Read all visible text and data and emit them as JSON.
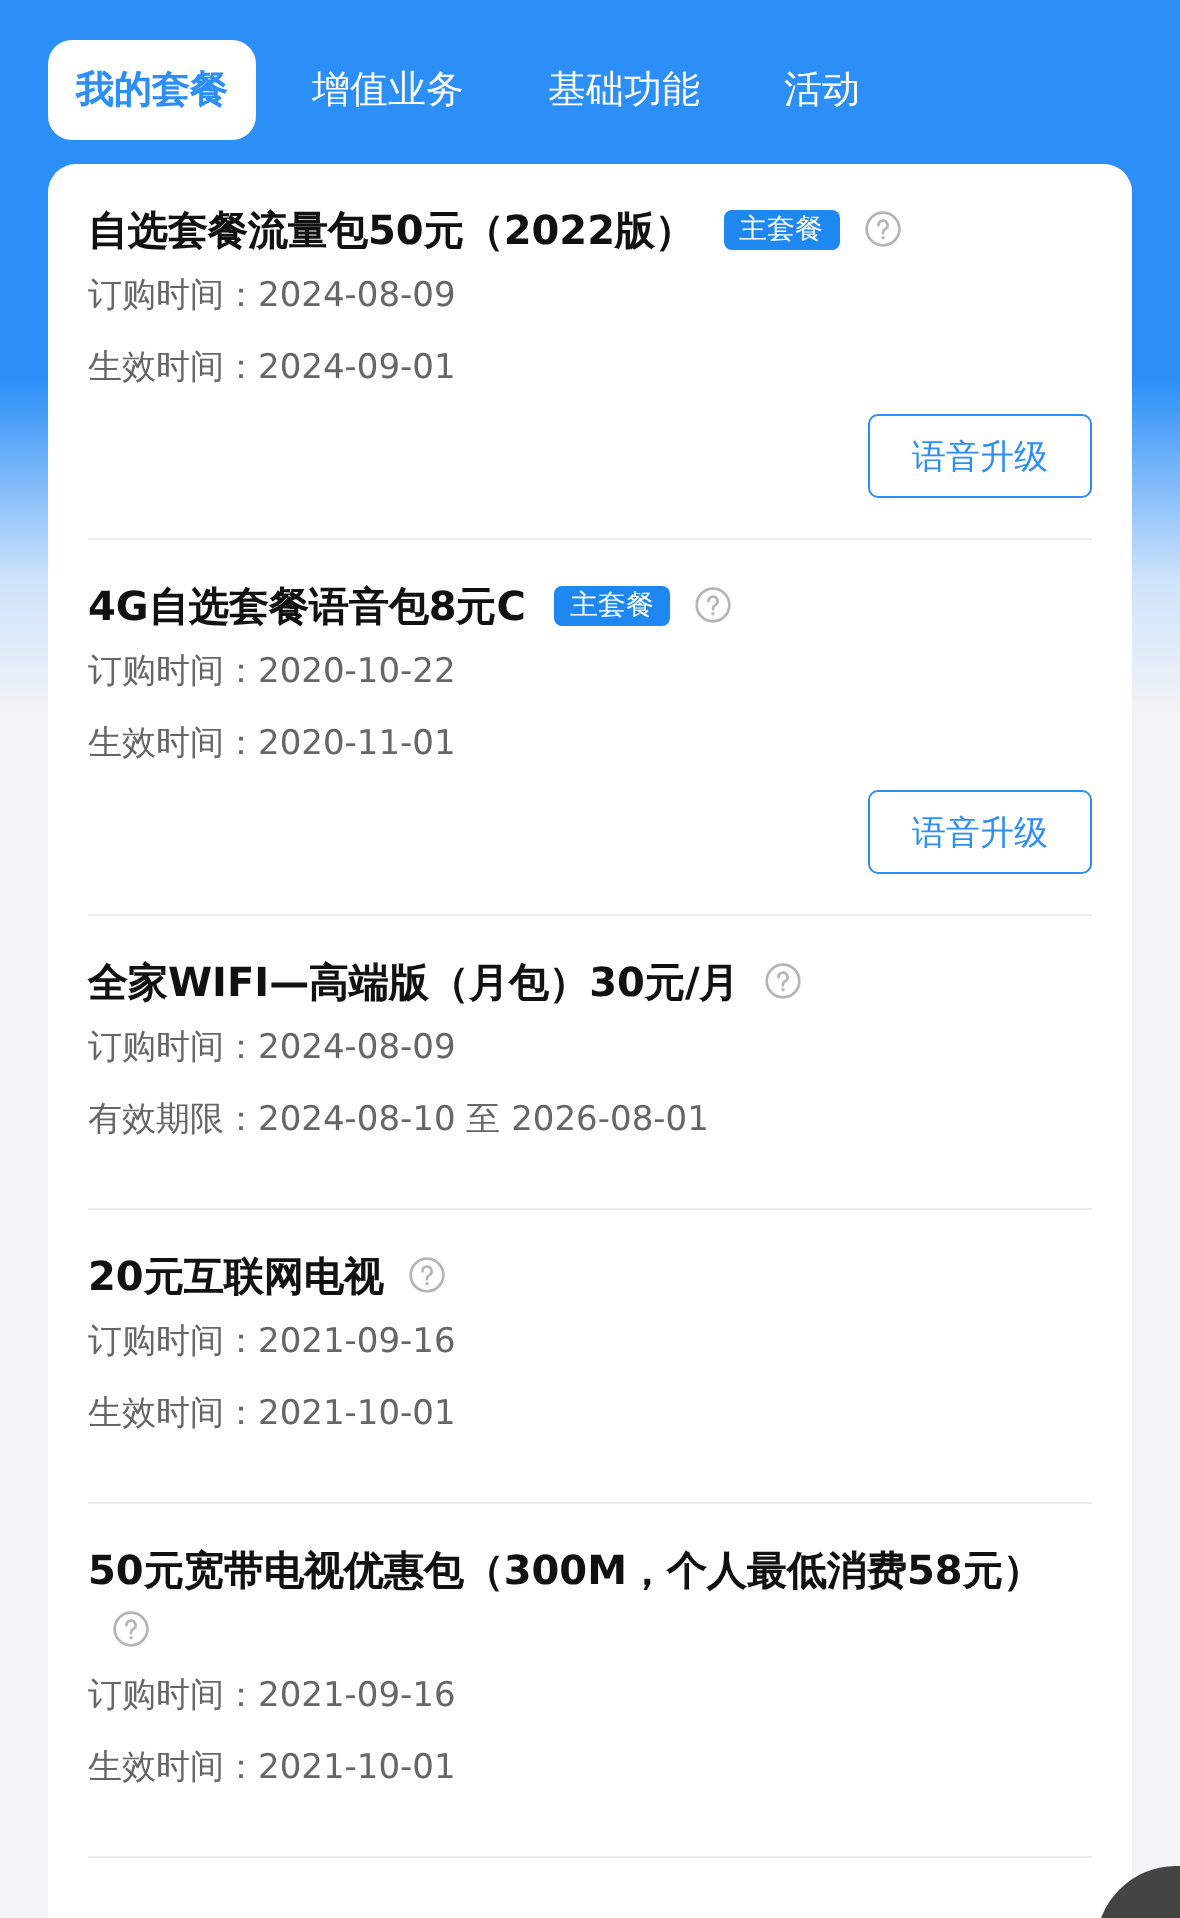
{
  "tabs": [
    {
      "label": "我的套餐",
      "selected": true
    },
    {
      "label": "增值业务",
      "selected": false
    },
    {
      "label": "基础功能",
      "selected": false
    },
    {
      "label": "活动",
      "selected": false
    }
  ],
  "packages": [
    {
      "title": "自选套餐流量包50元（2022版）",
      "tag": "主套餐",
      "rows": [
        {
          "label": "订购时间：",
          "value": "2024-08-09"
        },
        {
          "label": "生效时间：",
          "value": "2024-09-01"
        }
      ],
      "button": "语音升级"
    },
    {
      "title": "4G自选套餐语音包8元C",
      "tag": "主套餐",
      "rows": [
        {
          "label": "订购时间：",
          "value": "2020-10-22"
        },
        {
          "label": "生效时间：",
          "value": "2020-11-01"
        }
      ],
      "button": "语音升级"
    },
    {
      "title": "全家WIFI—高端版（月包）30元/月",
      "rows": [
        {
          "label": "订购时间：",
          "value": "2024-08-09"
        },
        {
          "label": "有效期限：",
          "value": "2024-08-10 至 2026-08-01"
        }
      ]
    },
    {
      "title": "20元互联网电视",
      "rows": [
        {
          "label": "订购时间：",
          "value": "2021-09-16"
        },
        {
          "label": "生效时间：",
          "value": "2021-10-01"
        }
      ]
    },
    {
      "title": "50元宽带电视优惠包（300M，个人最低消费58元）",
      "rows": [
        {
          "label": "订购时间：",
          "value": "2021-09-16"
        },
        {
          "label": "生效时间：",
          "value": "2021-10-01"
        }
      ]
    }
  ]
}
